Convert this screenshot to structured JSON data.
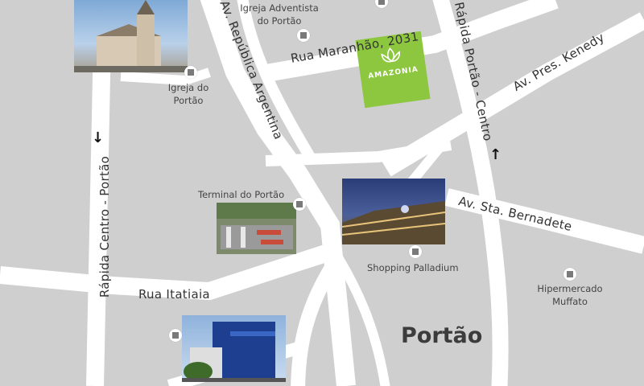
{
  "roads": {
    "rua_maranhao": "Rua Maranhão, 2031",
    "av_republica": "Av. República Argentina",
    "rapida_centro": "Rápida Portão - Centro",
    "av_pres_kenedy": "Av. Pres. Kenedy",
    "av_sta_bernadete": "Av. Sta. Bernadete",
    "rua_itatiaia": "Rua Itatiaia",
    "rapida_centro_portao": "Rápida Centro - Portão"
  },
  "pois": {
    "igreja_adventista": "Igreja Adventista do Portão",
    "igreja_portao": "Igreja do Portão",
    "terminal": "Terminal do Portão",
    "shopping": "Shopping Palladium",
    "hipermercado": "Hipermercado Muffato"
  },
  "district": "Portão",
  "logo": {
    "name": "AMAZONIA",
    "color": "#8dc63f"
  },
  "icons": [
    "church-photo",
    "bus-terminal-photo",
    "shopping-mall-photo",
    "building-photo",
    "map-pin-icon",
    "lotus-logo-icon",
    "arrow-up-icon",
    "arrow-down-icon"
  ]
}
